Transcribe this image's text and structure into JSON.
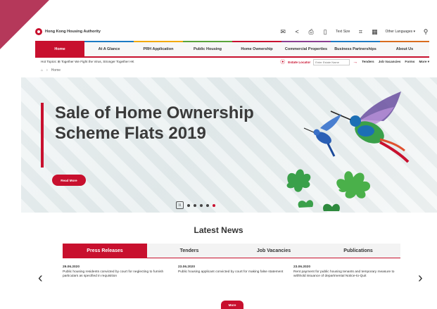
{
  "header": {
    "logo_text": "Hong Kong Housing Authority",
    "text_size": "Text Size",
    "other_languages": "Other Languages",
    "icons": [
      "mail-icon",
      "share-icon",
      "print-icon",
      "mobile-icon",
      "sitemap-icon",
      "accessibility-icon",
      "search-icon"
    ]
  },
  "nav": {
    "items": [
      {
        "label": "Home"
      },
      {
        "label": "At A Glance"
      },
      {
        "label": "PRH Application"
      },
      {
        "label": "Public Housing"
      },
      {
        "label": "Home Ownership"
      },
      {
        "label": "Commercial Properties"
      },
      {
        "label": "Business Partnerships"
      },
      {
        "label": "About Us"
      }
    ]
  },
  "hotbar": {
    "hot_topics": "Hot Topics: ⊞ Together We Fight the Virus, Stronger Together HK",
    "estate_locator": "Estate Locator",
    "locator_placeholder": "Enter Estate Name",
    "quick_links": [
      "Tenders",
      "Job Vacancies",
      "Forms",
      "More ▾"
    ]
  },
  "breadcrumb": {
    "home": "Home"
  },
  "banner": {
    "headline": "Sale of Home Ownership Scheme Flats 2019",
    "read_more": "Read More",
    "pause": "II"
  },
  "news": {
    "title": "Latest News",
    "tabs": [
      "Press Releases",
      "Tenders",
      "Job Vacancies",
      "Publications"
    ],
    "items": [
      {
        "date": "29.06.2020",
        "text": "Public housing residents convicted by court for neglecting to furnish particulars as specified in requisition"
      },
      {
        "date": "23.06.2020",
        "text": "Public housing applicant convicted by court for making false statement"
      },
      {
        "date": "23.06.2020",
        "text": "Rent payment for public housing tenants and temporary measure to withhold issuance of departmental Notice-to-Quit"
      }
    ],
    "prev": "‹",
    "next": "›",
    "more": "More"
  },
  "colors": {
    "brand": "#c8102e",
    "corner": "#b5385a"
  }
}
